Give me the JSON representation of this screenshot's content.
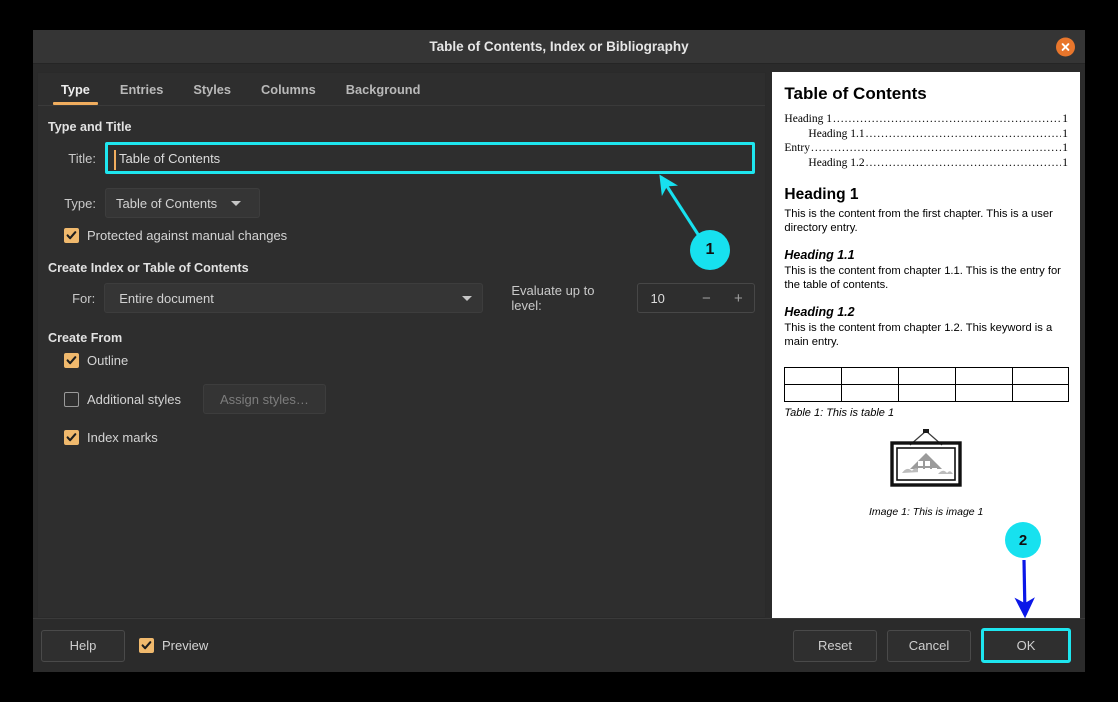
{
  "window": {
    "title": "Table of Contents, Index or Bibliography",
    "close_icon": "close-icon"
  },
  "tabs": [
    {
      "label": "Type",
      "active": true
    },
    {
      "label": "Entries",
      "active": false
    },
    {
      "label": "Styles",
      "active": false
    },
    {
      "label": "Columns",
      "active": false
    },
    {
      "label": "Background",
      "active": false
    }
  ],
  "sections": {
    "type_and_title": {
      "heading": "Type and Title",
      "title_label": "Title:",
      "title_value": "Table of Contents",
      "type_label": "Type:",
      "type_value": "Table of Contents",
      "protected_label": "Protected against manual changes",
      "protected_checked": true
    },
    "create_index": {
      "heading": "Create Index or Table of Contents",
      "for_label": "For:",
      "for_value": "Entire document",
      "evaluate_label": "Evaluate up to level:",
      "evaluate_value": "10",
      "minus_label": "−",
      "plus_label": "+"
    },
    "create_from": {
      "heading": "Create From",
      "outline_label": "Outline",
      "outline_checked": true,
      "additional_styles_label": "Additional styles",
      "additional_styles_checked": false,
      "assign_styles_label": "Assign styles…",
      "index_marks_label": "Index marks",
      "index_marks_checked": true
    }
  },
  "preview": {
    "title": "Table of Contents",
    "toc": [
      {
        "text": "Heading 1",
        "page": "1",
        "level": 1
      },
      {
        "text": "Heading 1.1",
        "page": "1",
        "level": 2
      },
      {
        "text": "Entry",
        "page": "1",
        "level": 1
      },
      {
        "text": "Heading 1.2",
        "page": "1",
        "level": 2
      }
    ],
    "blocks": [
      {
        "heading": "Heading 1",
        "level": 1,
        "body": "This is the content from the first chapter. This is a user directory entry."
      },
      {
        "heading": "Heading 1.1",
        "level": 2,
        "body": "This is the content from chapter 1.1. This is the entry for the table of contents."
      },
      {
        "heading": "Heading 1.2",
        "level": 2,
        "body": "This is the content from chapter 1.2. This keyword is a main entry."
      }
    ],
    "table_caption": "Table 1: This is table 1",
    "image_caption": "Image 1: This is image 1",
    "image_icon": "picture-frame-icon"
  },
  "footer": {
    "help_label": "Help",
    "preview_label": "Preview",
    "preview_checked": true,
    "reset_label": "Reset",
    "cancel_label": "Cancel",
    "ok_label": "OK"
  },
  "annotations": [
    {
      "number": "1",
      "color": "#17e1ef",
      "target": "title-field"
    },
    {
      "number": "2",
      "color": "#17e1ef",
      "arrow_color": "#0b17e8",
      "target": "ok-button"
    }
  ]
}
